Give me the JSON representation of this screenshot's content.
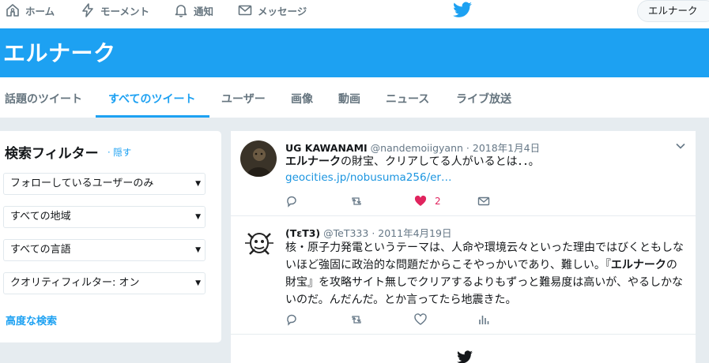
{
  "topnav": {
    "home": "ホーム",
    "moments": "モーメント",
    "notifications": "通知",
    "messages": "メッセージ",
    "user_pill": "エルナーク"
  },
  "banner": {
    "title": "エルナーク"
  },
  "tabs": [
    {
      "label": "話題のツイート",
      "active": false
    },
    {
      "label": "すべてのツイート",
      "active": true
    },
    {
      "label": "ユーザー",
      "active": false
    },
    {
      "label": "画像",
      "active": false
    },
    {
      "label": "動画",
      "active": false
    },
    {
      "label": "ニュース",
      "active": false
    },
    {
      "label": "ライブ放送",
      "active": false
    }
  ],
  "filter": {
    "title": "検索フィルター",
    "hide": "· 隠す",
    "selects": [
      "フォローしているユーザーのみ",
      "すべての地域",
      "すべての言語",
      "クオリティフィルター: オン"
    ],
    "advanced": "高度な検索"
  },
  "tweets": [
    {
      "name": "UG KAWANAMI",
      "handle": "@nandemoiigyann",
      "dot": "·",
      "date": "2018年1月4日",
      "text_bold": "エルナーク",
      "text_rest": "の財宝、クリアしてる人がいるとは．．。",
      "link": "geocities.jp/nobusuma256/er…",
      "like_count": "2",
      "liked": true
    },
    {
      "name": "(TεT3)",
      "handle": "@TeT333",
      "dot": "·",
      "date": "2011年4月19日",
      "line1": "核・原子力発電というテーマは、人命や環境云々といった理由ではびくともしな",
      "line2_pre": "いほど強固に政治的な問題だからこそやっかいであり、難しい。『",
      "line2_bold": "エルナーク",
      "line2_post": "の",
      "line3": "財宝』を攻略サイト無しでクリアするよりもずっと難易度は高いが、やるしかな",
      "line4": "いのだ。んだんだ。とか言ってたら地震きた。"
    }
  ],
  "colors": {
    "brand": "#1da1f2",
    "like": "#e0245e",
    "muted": "#657786"
  }
}
